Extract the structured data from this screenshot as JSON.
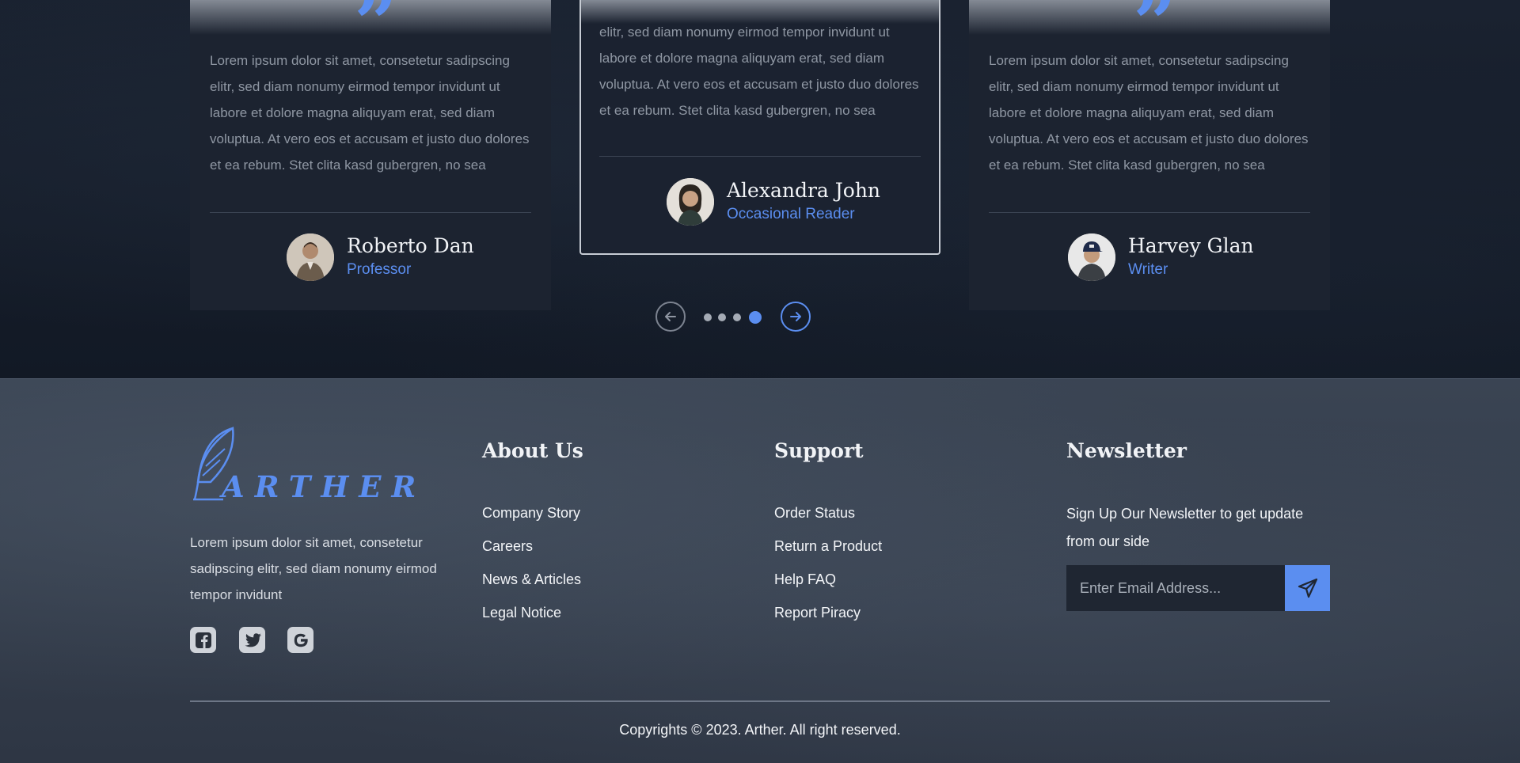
{
  "testimonials": {
    "quote_glyph": "”",
    "cards": [
      {
        "text": "Lorem ipsum dolor sit amet, consetetur sadipscing elitr, sed diam nonumy eirmod tempor invidunt ut labore et dolore magna aliquyam erat, sed diam voluptua. At vero eos et accusam et justo duo dolores et ea rebum. Stet clita kasd gubergren, no sea",
        "name": "Roberto Dan",
        "role": "Professor",
        "avatar_icon": "person-avatar"
      },
      {
        "text": "elitr, sed diam nonumy eirmod tempor invidunt ut labore et dolore magna aliquyam erat, sed diam voluptua. At vero eos et accusam et justo duo dolores et ea rebum. Stet clita kasd gubergren, no sea",
        "name": "Alexandra John",
        "role": "Occasional Reader",
        "avatar_icon": "person-avatar"
      },
      {
        "text": "Lorem ipsum dolor sit amet, consetetur sadipscing elitr, sed diam nonumy eirmod tempor invidunt ut labore et dolore magna aliquyam erat, sed diam voluptua. At vero eos et accusam et justo duo dolores et ea rebum. Stet clita kasd gubergren, no sea",
        "name": "Harvey Glan",
        "role": "Writer",
        "avatar_icon": "person-avatar"
      }
    ],
    "slider": {
      "prev_icon": "arrow-left-icon",
      "next_icon": "arrow-right-icon",
      "dot_count": 4,
      "active_dot": 4
    }
  },
  "footer": {
    "brand": "ARTHER",
    "brand_icon": "feather-icon",
    "description": "Lorem ipsum dolor sit amet, consetetur sadipscing elitr, sed diam nonumy eirmod tempor invidunt",
    "social": [
      "facebook-icon",
      "twitter-icon",
      "google-icon"
    ],
    "about": {
      "title": "About Us",
      "links": [
        "Company Story",
        "Careers",
        "News & Articles",
        "Legal Notice"
      ]
    },
    "support": {
      "title": "Support",
      "links": [
        "Order Status",
        "Return a Product",
        "Help FAQ",
        "Report Piracy"
      ]
    },
    "newsletter": {
      "title": "Newsletter",
      "text": "Sign Up Our Newsletter to get update from our side",
      "placeholder": "Enter Email Address...",
      "send_icon": "paper-plane-icon"
    },
    "copyright": "Copyrights © 2023. Arther. All right reserved."
  },
  "colors": {
    "accent": "#5b8ef0",
    "background": "#141a24",
    "footer_background": "#39424f",
    "card_background": "#1c2330"
  }
}
